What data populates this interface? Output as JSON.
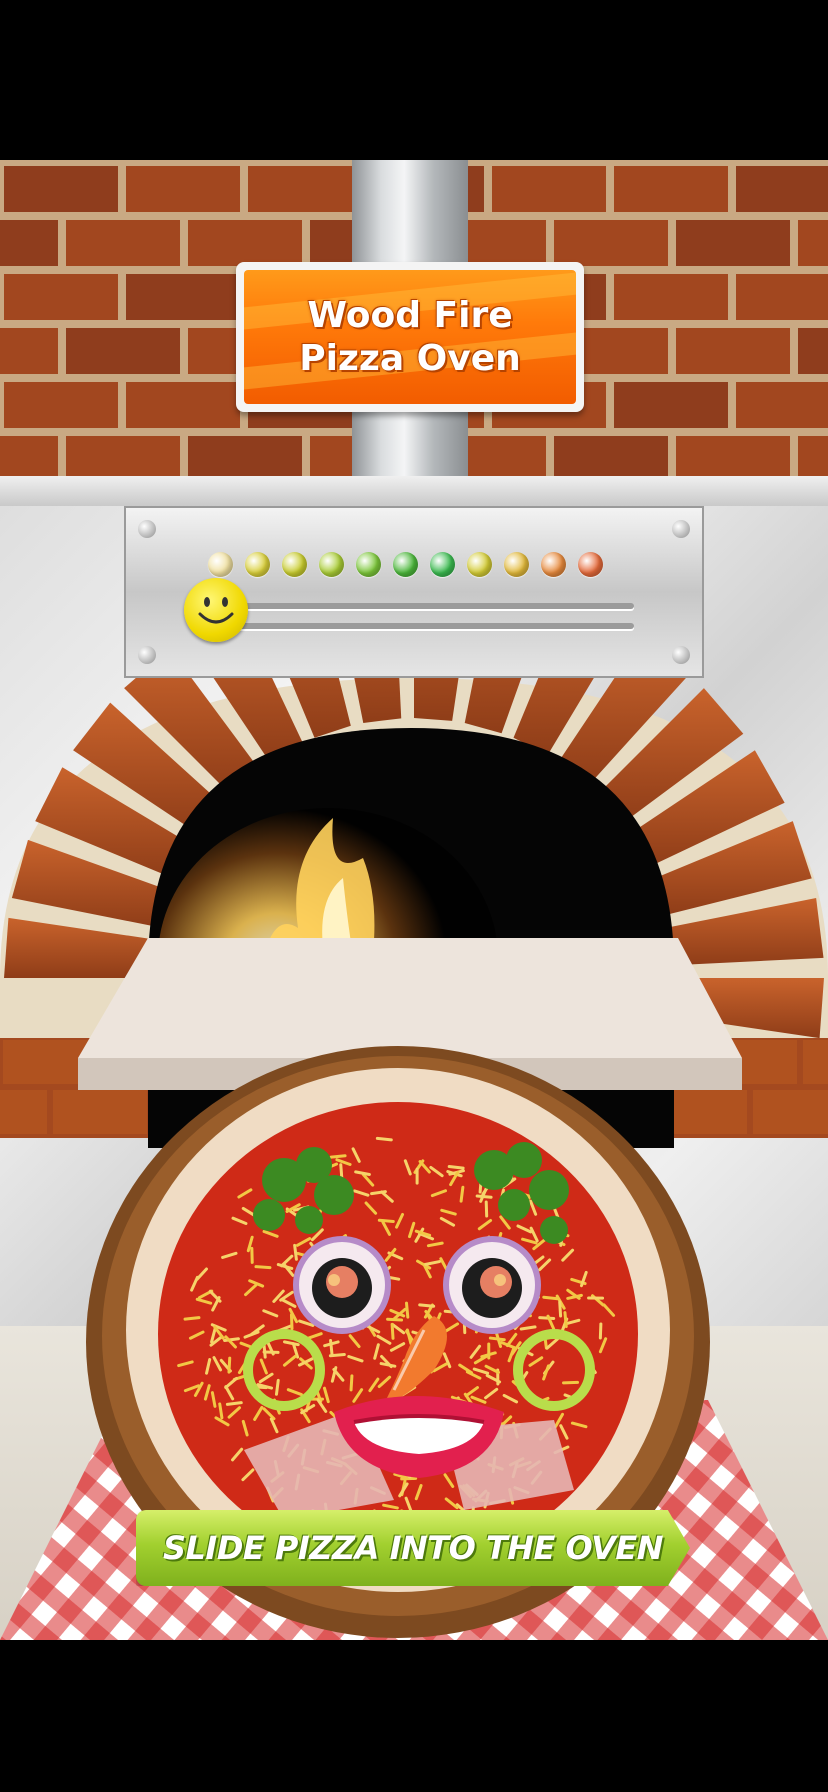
{
  "game": {
    "sign": {
      "line1": "Wood Fire",
      "line2": "Pizza Oven"
    },
    "doneness_meter": {
      "led_colors": [
        "#f0e0a0",
        "#d9cf3a",
        "#c8cc2e",
        "#a9cc35",
        "#7cc73a",
        "#4cb83b",
        "#3aba4f",
        "#d3cb34",
        "#e2b93a",
        "#e78a3d",
        "#e56a3a"
      ],
      "indicator": "smiley-face-icon",
      "level": 0
    },
    "action_button": {
      "label": "SLIDE PIZZA INTO THE OVEN"
    },
    "colors": {
      "brick": "#a2471f",
      "sign_orange": "#f57507",
      "button_green": "#9cc82c",
      "sauce": "#cf2a17",
      "cheese": "#f2c845"
    }
  }
}
